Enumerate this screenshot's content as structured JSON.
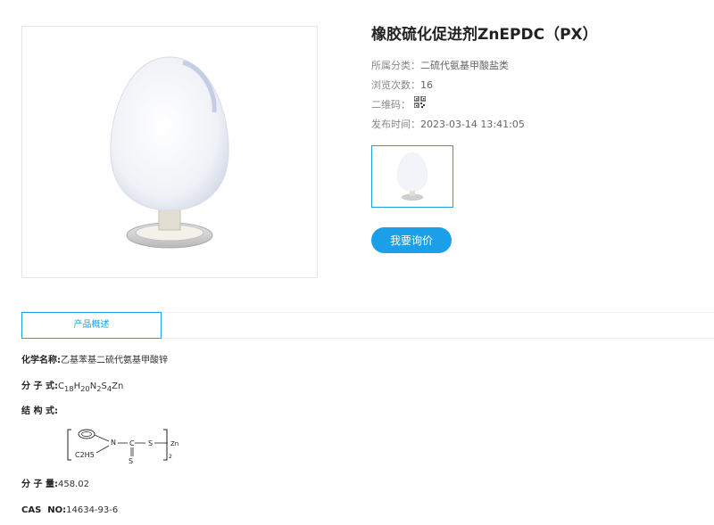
{
  "product": {
    "title": "橡胶硫化促进剂ZnEPDC（PX）",
    "category_label": "所属分类：",
    "category_value": "二硫代氨基甲酸盐类",
    "views_label": "浏览次数：",
    "views_value": "16",
    "qr_label": "二维码：",
    "publish_label": "发布时间：",
    "publish_value": "2023-03-14 13:41:05",
    "inquiry_button": "我要询价"
  },
  "tabs": [
    {
      "label": "产品概述",
      "active": true
    }
  ],
  "details": {
    "chem_name_label": "化学名称:",
    "chem_name_value": "乙基苯基二硫代氨基甲酸锌",
    "formula_label": "分 子 式:",
    "formula_parts": [
      "C",
      "18",
      "H",
      "20",
      "N",
      "2",
      "S",
      "4",
      "Zn"
    ],
    "structure_label": "结 构 式:",
    "structure_text": {
      "n": "N",
      "c": "C",
      "s1": "S",
      "s2": "S",
      "zn": "Zn",
      "ethyl": "C2H5",
      "sub": "2"
    },
    "mw_label": "分 子 量:",
    "mw_value": "458.02",
    "cas_label": "CAS  NO:",
    "cas_value": "14634-93-6"
  },
  "colors": {
    "accent": "#1a9fe8",
    "tab_border": "#1e9fe0",
    "divider": "#eeeeee"
  },
  "icons": [
    "qr-code-icon"
  ]
}
